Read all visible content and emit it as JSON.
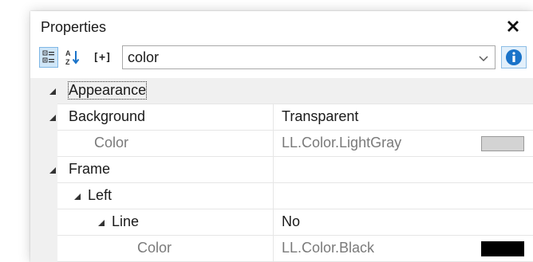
{
  "panel": {
    "title": "Properties"
  },
  "toolbar": {
    "expand_label": "[+]",
    "search_value": "color",
    "colors": {
      "selected_bg": "#cfe6f8",
      "info_blue": "#1a73c9"
    }
  },
  "rows": [
    {
      "name": "Appearance",
      "value": "",
      "type": "category"
    },
    {
      "name": "Background",
      "value": "Transparent",
      "type": "property"
    },
    {
      "name": "Color",
      "value": "LL.Color.LightGray",
      "type": "property",
      "swatch": "#d3d3d3"
    },
    {
      "name": "Frame",
      "value": "",
      "type": "property"
    },
    {
      "name": "Left",
      "value": "",
      "type": "property"
    },
    {
      "name": "Line",
      "value": "No",
      "type": "property"
    },
    {
      "name": "Color",
      "value": "LL.Color.Black",
      "type": "property",
      "swatch": "#000000"
    }
  ]
}
